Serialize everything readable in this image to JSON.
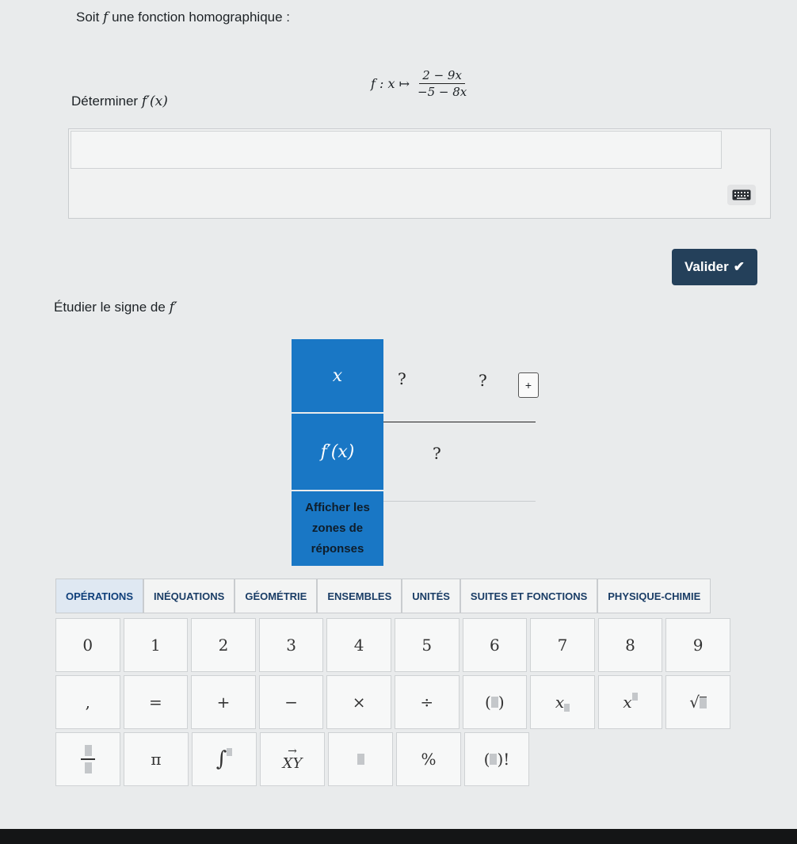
{
  "intro": {
    "prefix": "Soit",
    "func": "f",
    "suffix": "une fonction homographique :"
  },
  "formula": {
    "lhs": "f : x ↦",
    "numerator": "2 − 9x",
    "denominator": "−5 − 8x"
  },
  "determine": {
    "label": "Déterminer",
    "expr": "f′(x)"
  },
  "answer": {
    "value": ""
  },
  "valider": {
    "label": "Valider",
    "icon": "check-icon"
  },
  "study": {
    "label": "Étudier le signe de",
    "expr": "f′"
  },
  "sign_table": {
    "x_label": "x",
    "fp_label": "f′(x)",
    "q1": "?",
    "q2": "?",
    "q3": "?",
    "plus": "+",
    "show_answers": "Afficher les zones de réponses"
  },
  "tabs": [
    "OPÉRATIONS",
    "INÉQUATIONS",
    "GÉOMÉTRIE",
    "ENSEMBLES",
    "UNITÉS",
    "SUITES ET FONCTIONS",
    "PHYSIQUE-CHIMIE"
  ],
  "keys": {
    "row1": [
      "0",
      "1",
      "2",
      "3",
      "4",
      "5",
      "6",
      "7",
      "8",
      "9"
    ],
    "row2": [
      ",",
      "=",
      "+",
      "−",
      "×",
      "÷"
    ],
    "row2_special": {
      "paren": "( )",
      "sub": "x",
      "sup": "x",
      "sqrt": "√"
    },
    "row3": {
      "pi": "π",
      "integral": "∫",
      "vector": "XY",
      "percent": "%",
      "fact": "( )!"
    }
  }
}
